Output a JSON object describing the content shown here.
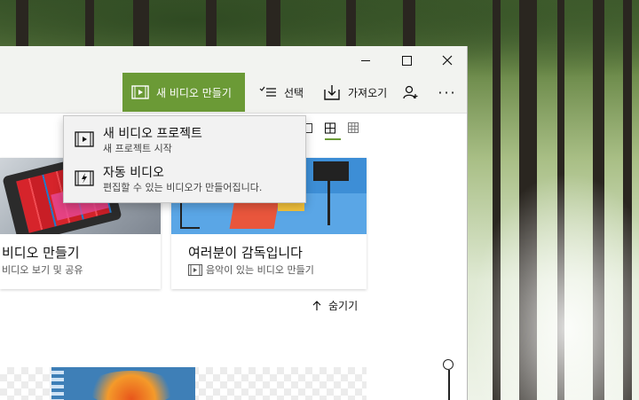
{
  "toolbar": {
    "new_video_label": "새 비디오 만들기",
    "select_label": "선택",
    "import_label": "가져오기",
    "more_label": "···"
  },
  "dropdown": {
    "items": [
      {
        "title": "새 비디오 프로젝트",
        "subtitle": "새 프로젝트 시작",
        "icon": "video-project-icon"
      },
      {
        "title": "자동 비디오",
        "subtitle": "편집할 수 있는 비디오가 만들어집니다.",
        "icon": "auto-video-icon"
      }
    ]
  },
  "cards": [
    {
      "title": "비디오 만들기",
      "subtitle": "비디오 보기 및 공유"
    },
    {
      "title": "여러분이 감독입니다",
      "subtitle": "음악이 있는 비디오 만들기",
      "icon": "video-icon"
    }
  ],
  "collapse_label": "숨기기",
  "colors": {
    "accent": "#6b9a36",
    "titlebar": "#f2f3f0",
    "dropdown_bg": "#f2f2f2"
  }
}
